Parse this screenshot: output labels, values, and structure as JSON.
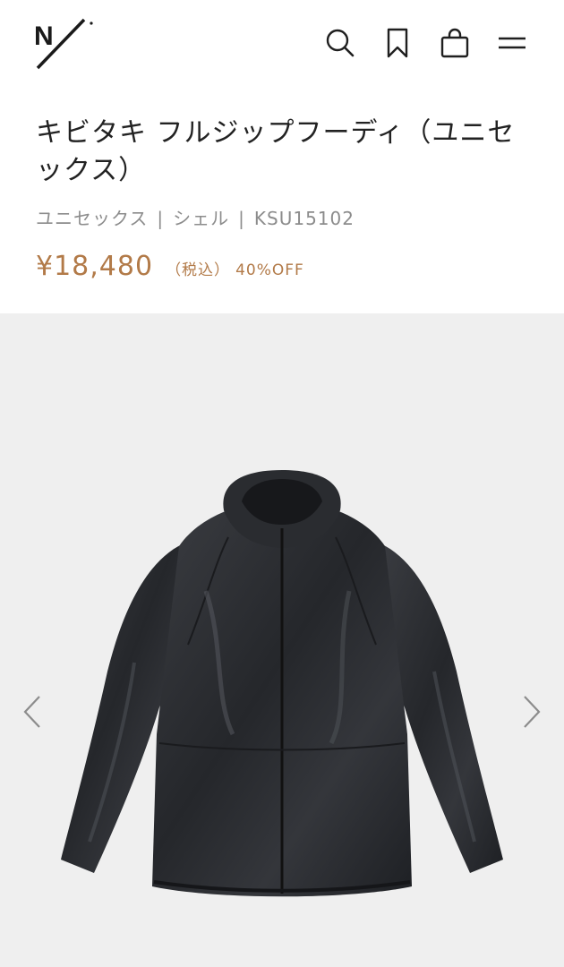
{
  "header": {
    "logo_text": "N/"
  },
  "icons": {
    "search": "search-icon",
    "bookmark": "bookmark-icon",
    "cart": "shopping-bag-icon",
    "menu": "menu-icon",
    "prev": "chevron-left-icon",
    "next": "chevron-right-icon"
  },
  "product": {
    "title": "キビタキ フルジップフーディ（ユニセックス）",
    "gender": "ユニセックス",
    "category": "シェル",
    "code": "KSU15102",
    "separator": "|",
    "price": "¥18,480",
    "tax_note": "（税込）",
    "discount": "40%OFF"
  },
  "colors": {
    "price": "#b27a48",
    "meta": "#8c8c8c",
    "gallery_bg": "#efefef"
  }
}
